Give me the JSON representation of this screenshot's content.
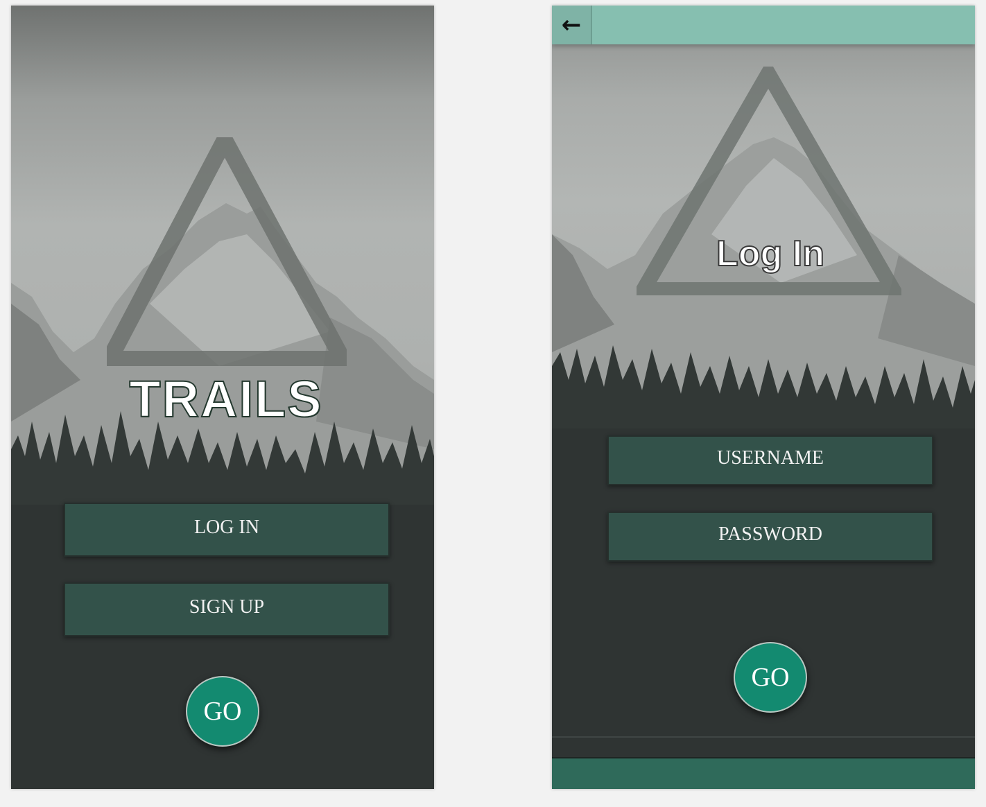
{
  "home_screen": {
    "app_title": "TRAILS",
    "login_button": "LOG IN",
    "signup_button": "SIGN UP",
    "go_button": "GO"
  },
  "login_screen": {
    "back_icon": "arrow-left-icon",
    "back_glyph": "←",
    "title": "Log In",
    "username_field": "USERNAME",
    "password_field": "PASSWORD",
    "go_button": "GO"
  },
  "colors": {
    "field_bg": "#33524a",
    "go_bg": "#138a70",
    "header_bar": "#86bfb0",
    "footer_bar": "#2f6a5a",
    "dark_ground": "#2f3433"
  }
}
